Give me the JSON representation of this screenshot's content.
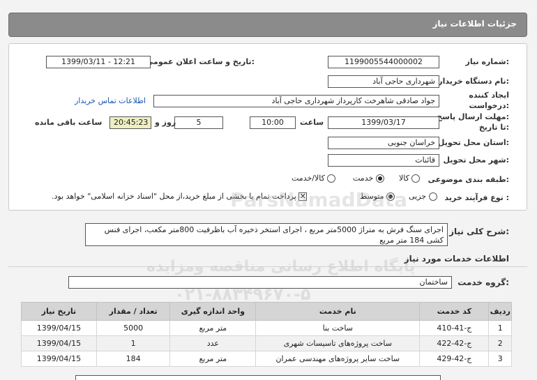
{
  "header": {
    "title": "جزئیات اطلاعات نیاز"
  },
  "form": {
    "need_number_label": "شماره نیاز:",
    "need_number": "1199005544000002",
    "announce_label": "تاریخ و ساعت اعلان عمومی:",
    "announce_value": "1399/03/11 - 12:21",
    "buyer_label": "نام دستگاه خریدار:",
    "buyer": "شهرداری حاجی آباد",
    "requester_label_1": "ایجاد کننده",
    "requester_label_2": "درخواست:",
    "requester": "جواد صادقی شاهرخت کارپرداز شهرداری حاجی آباد",
    "contact_link": "اطلاعات تماس خریدار",
    "deadline_label_1": "مهلت ارسال پاسخ:",
    "deadline_label_2": "تا تاریخ:",
    "deadline_date": "1399/03/17",
    "time_label": "ساعت",
    "deadline_time": "10:00",
    "days": "5",
    "days_label": "روز و",
    "remaining": "20:45:23",
    "remaining_label": "ساعت باقی مانده",
    "province_label": "استان محل تحویل:",
    "province": "خراسان جنوبی",
    "city_label": "شهر محل تحویل:",
    "city": "قائنات",
    "category_label": "طبقه بندی موضوعی:",
    "category_options": [
      "کالا",
      "خدمت",
      "کالا/خدمت"
    ],
    "category_selected": 1,
    "process_label": "نوع فرآیند خرید :",
    "process_options": [
      "جزیی",
      "متوسط"
    ],
    "process_selected": 1,
    "payment_note": "پرداخت تمام یا بخشی از مبلغ خرید،از محل \"اسناد خزانه اسلامی\" خواهد بود."
  },
  "description": {
    "label": "شرح کلی نیاز:",
    "text": "اجرای سنگ فرش به متراژ 5000متر مربع ، اجرای استخر ذخیره آب باظرفیت 800متر مکعب، اجرای فنس کشی 184 متر مربع"
  },
  "services": {
    "section_title": "اطلاعات خدمات مورد نیاز",
    "group_label": "گروه خدمت:",
    "group_value": "ساختمان",
    "columns": [
      "ردیف",
      "کد خدمت",
      "نام خدمت",
      "واحد اندازه گیری",
      "تعداد / مقدار",
      "تاریخ نیاز"
    ],
    "rows": [
      [
        "1",
        "ج-41-410",
        "ساخت بنا",
        "متر مربع",
        "5000",
        "1399/04/15"
      ],
      [
        "2",
        "ج-42-422",
        "ساخت پروژه‌های تاسیسات شهری",
        "عدد",
        "1",
        "1399/04/15"
      ],
      [
        "3",
        "ج-42-429",
        "ساخت سایر پروژه‌های مهندسی عمران",
        "متر مربع",
        "184",
        "1399/04/15"
      ]
    ]
  },
  "watermark": {
    "line1": "ParsNamadData",
    "line2": "پایگاه اطلاع رسانی مناقصه ومزایده",
    "line3": "۰۲۱-۸۸۳۴۹۶۷۰-۵"
  }
}
